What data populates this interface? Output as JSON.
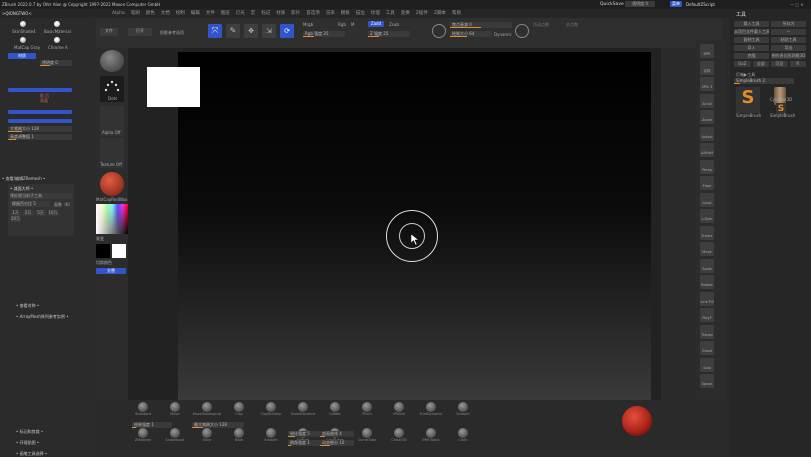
{
  "titlebar": {
    "app_title": "ZBrush 2022.0.7 by Ofer Alon @ Copyright 1997-2022 Maxon Computer GmbH",
    "quicksave": "QuickSave",
    "status_value": "透明度 0",
    "menu_label": "菜单",
    "script": "DefaultZScript"
  },
  "menubar": {
    "items": [
      "Alpha",
      "笔刷",
      "颜色",
      "文档",
      "绘制",
      "编辑",
      "文件",
      "图层",
      "灯光",
      "宏",
      "标记",
      "材质",
      "影片",
      "首选项",
      "渲染",
      "模板",
      "描边",
      "纹理",
      "工具",
      "变换",
      "Z插件",
      "Z脚本",
      "帮助"
    ],
    "tab": ">QIONGTWO<"
  },
  "left_panel": {
    "materials": [
      {
        "name": "SkinShade4",
        "color": "#d8d0cc"
      },
      {
        "name": "BasicMaterial",
        "color": "#e8e8e8"
      },
      {
        "name": "MatCap Gray",
        "color": "#cccccc"
      },
      {
        "name": "Chrome A",
        "color": "#e0e0e0"
      }
    ],
    "items": [
      {
        "label": "材质",
        "value": "",
        "style": "blue"
      },
      {
        "label": "透明度",
        "value": "0",
        "style": "slider"
      },
      {
        "label": "启用深度",
        "value": "",
        "style": "blue"
      },
      {
        "label": "",
        "value": "",
        "style": "blue"
      },
      {
        "label": "大笔刷大小",
        "value": "128",
        "style": "slider"
      },
      {
        "label": "高度调整值",
        "value": "1",
        "style": "slider"
      }
    ],
    "section_title": "• 查看/编辑ZRemesh •",
    "sub_title": "• 减面大师 •",
    "stats_label": "预处理当前子工具",
    "row_label": "保留百分比",
    "row_value": "5",
    "row_right": "面数（K）",
    "lod_buttons": [
      "1万",
      "2万",
      "5万",
      "10万",
      "20万"
    ],
    "lower_items": [
      "• 查看对称 •",
      "• ArrayMesh阵列参考实例 •"
    ],
    "bottom_items": [
      "• 标记和剪裁 •",
      "• 环境贴图 •",
      "• 画笔工具选择 •"
    ]
  },
  "toolbar": {
    "left_btn": "文件",
    "left_btn2": "打开",
    "projection_label": "投影参考选项",
    "edit_label": "编辑",
    "draw_label": "绘制",
    "move_label": "移动",
    "scale_label": "缩放",
    "rotate_label": "旋转",
    "mrgb": "Mrgb",
    "rgb": "Rgb",
    "m": "M",
    "zadd": "Zadd",
    "zsub": "Zsub",
    "rgb_intensity_label": "Rgb 强度",
    "rgb_intensity": "25",
    "z_intensity_label": "Z 强度",
    "z_intensity": "25",
    "focal_label": "焦点衰减",
    "focal_value": "0",
    "draw_size_label": "绘制大小",
    "draw_size_value": "64",
    "dynamic": "Dynamic",
    "active_points": "活动点数",
    "total_points": "总点数"
  },
  "shelf": {
    "items": [
      {
        "name": "Standard",
        "label": ""
      },
      {
        "name": "Dots",
        "label": "Dots"
      },
      {
        "name": "Alpha Off",
        "label": "Alpha Off"
      },
      {
        "name": "Texture Off",
        "label": "Texture Off"
      },
      {
        "name": "MatCap Red Wax",
        "label": "MatCapRedWax"
      }
    ],
    "gradient_label": "渐变",
    "switch_label": "切换颜色",
    "alternate": "交替"
  },
  "right_shelf": {
    "labels": [
      "BPR",
      "实际",
      "SPix 3",
      "Scroll",
      "Zoom",
      "Actual",
      "AAHalf",
      "Persp",
      "Floor",
      "Local",
      "L.Sym",
      "Frame",
      "Move",
      "Scale",
      "Rotate",
      "Line Fill",
      "PolyF",
      "Transp",
      "Ghost",
      "Solo",
      "Xpose"
    ]
  },
  "right_panel": {
    "title": "工具",
    "buttons": [
      [
        "载入工具",
        "另存为"
      ],
      [
        "从项目文件载入工具",
        "—"
      ],
      [
        "复制工具",
        "粘贴工具"
      ],
      [
        "导入",
        "导出"
      ],
      [
        "克隆",
        "制作多边形网格3D"
      ],
      [
        "GoZ",
        "全部",
        "可见",
        "R"
      ]
    ],
    "lightbox": "灯箱▶工具",
    "current_tool": "SimpleBrush  2",
    "tool_thumbs": [
      {
        "name": "SimpleBrush",
        "color": "#e58b2a"
      },
      {
        "name": "Cylinder3D",
        "color": "#9a7a5a"
      },
      {
        "name": "SimpleBrush",
        "color": "#e58b2a"
      }
    ]
  },
  "bottom_bar": {
    "brushes": [
      "Standard",
      "Move",
      "MoveTopological",
      "Clay",
      "ClayBuildup",
      "DamStandard",
      "Inflate",
      "Pinch",
      "hPolish",
      "TrimDynamic",
      "Smooth",
      "ZModeler",
      "Snakehook",
      "Slice",
      "Blob",
      "Smooth",
      "Flatten",
      "ClayTubes",
      "CurveTube",
      "Chisel3D",
      "IMM Basic",
      "Cloth"
    ],
    "sliders": [
      {
        "label": "绘制强度",
        "value": "1"
      },
      {
        "label": "最大笔刷大小",
        "value": "128"
      },
      {
        "label": "锐化强度",
        "value": "5"
      },
      {
        "label": "倒角强度",
        "value": "1"
      },
      {
        "label": "剖面曲线",
        "value": "4"
      },
      {
        "label": "动态细分",
        "value": "10"
      }
    ],
    "material_color": "#b02418"
  }
}
